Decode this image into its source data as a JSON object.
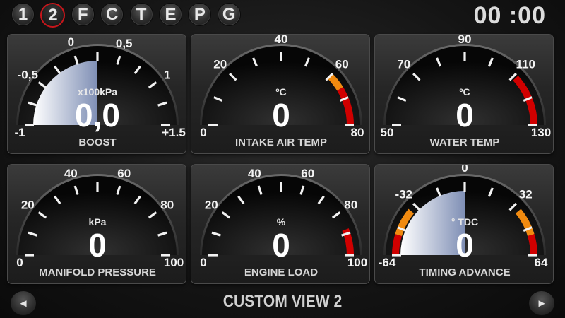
{
  "tabs": [
    {
      "label": "1",
      "active": false
    },
    {
      "label": "2",
      "active": true
    },
    {
      "label": "F",
      "active": false
    },
    {
      "label": "C",
      "active": false
    },
    {
      "label": "T",
      "active": false
    },
    {
      "label": "E",
      "active": false
    },
    {
      "label": "P",
      "active": false
    },
    {
      "label": "G",
      "active": false
    }
  ],
  "clock": "00 :00",
  "view_title": "CUSTOM VIEW 2",
  "nav": {
    "prev_icon": "◄",
    "next_icon": "►"
  },
  "colors": {
    "accent_red": "#d00000",
    "warn_orange": "#f08a10",
    "active_tab_ring": "#c8161b"
  },
  "gauges": [
    {
      "id": "boost",
      "name": "BOOST",
      "unit": "x100kPa",
      "value": "0,0",
      "min": -1,
      "max": 1.5,
      "reading": 0,
      "fill": "center",
      "labels": [
        {
          "text": "-1",
          "v": -1
        },
        {
          "text": "-0,5",
          "v": -0.5
        },
        {
          "text": "0",
          "v": 0
        },
        {
          "text": "0,5",
          "v": 0.5
        },
        {
          "text": "1",
          "v": 1
        },
        {
          "text": "+1.5",
          "v": 1.5
        }
      ],
      "ticks": 11,
      "zones": []
    },
    {
      "id": "intake-air-temp",
      "name": "INTAKE AIR TEMP",
      "unit": "ºC",
      "value": "0",
      "min": 0,
      "max": 80,
      "reading": 0,
      "fill": "none",
      "labels": [
        {
          "text": "0",
          "v": 0
        },
        {
          "text": "20",
          "v": 20
        },
        {
          "text": "40",
          "v": 40
        },
        {
          "text": "60",
          "v": 60
        },
        {
          "text": "80",
          "v": 80
        }
      ],
      "ticks": 9,
      "zones": [
        {
          "from": 60,
          "to": 66,
          "color": "orange"
        },
        {
          "from": 66,
          "to": 80,
          "color": "red"
        }
      ]
    },
    {
      "id": "water-temp",
      "name": "WATER TEMP",
      "unit": "ºC",
      "value": "0",
      "min": 50,
      "max": 130,
      "reading": 0,
      "fill": "none",
      "labels": [
        {
          "text": "50",
          "v": 50
        },
        {
          "text": "70",
          "v": 70
        },
        {
          "text": "90",
          "v": 90
        },
        {
          "text": "110",
          "v": 110
        },
        {
          "text": "130",
          "v": 130
        }
      ],
      "ticks": 9,
      "zones": [
        {
          "from": 111,
          "to": 130,
          "color": "red"
        }
      ]
    },
    {
      "id": "manifold-pressure",
      "name": "MANIFOLD PRESSURE",
      "unit": "kPa",
      "value": "0",
      "min": 0,
      "max": 100,
      "reading": 0,
      "fill": "none",
      "labels": [
        {
          "text": "0",
          "v": 0
        },
        {
          "text": "20",
          "v": 20
        },
        {
          "text": "40",
          "v": 40
        },
        {
          "text": "60",
          "v": 60
        },
        {
          "text": "80",
          "v": 80
        },
        {
          "text": "100",
          "v": 100
        }
      ],
      "ticks": 11,
      "zones": []
    },
    {
      "id": "engine-load",
      "name": "ENGINE LOAD",
      "unit": "%",
      "value": "0",
      "min": 0,
      "max": 100,
      "reading": 0,
      "fill": "none",
      "labels": [
        {
          "text": "0",
          "v": 0
        },
        {
          "text": "20",
          "v": 20
        },
        {
          "text": "40",
          "v": 40
        },
        {
          "text": "60",
          "v": 60
        },
        {
          "text": "80",
          "v": 80
        },
        {
          "text": "100",
          "v": 100
        }
      ],
      "ticks": 11,
      "zones": [
        {
          "from": 88,
          "to": 100,
          "color": "red"
        }
      ]
    },
    {
      "id": "timing-advance",
      "name": "TIMING ADVANCE",
      "unit": "° TDC",
      "value": "0",
      "min": -64,
      "max": 64,
      "reading": 0,
      "fill": "center",
      "labels": [
        {
          "text": "-64",
          "v": -64
        },
        {
          "text": "-32",
          "v": -32
        },
        {
          "text": "0",
          "v": 0
        },
        {
          "text": "32",
          "v": 32
        },
        {
          "text": "64",
          "v": 64
        }
      ],
      "ticks": 9,
      "zones": [
        {
          "from": -64,
          "to": -52,
          "color": "red"
        },
        {
          "from": -52,
          "to": -36,
          "color": "orange"
        },
        {
          "from": 36,
          "to": 52,
          "color": "orange"
        },
        {
          "from": 52,
          "to": 64,
          "color": "red"
        }
      ]
    }
  ]
}
